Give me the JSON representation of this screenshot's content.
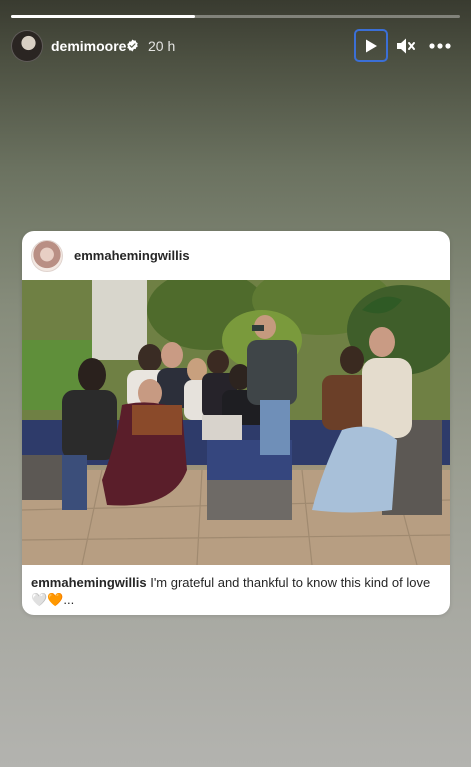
{
  "story": {
    "progress": 0.41
  },
  "header": {
    "username": "demimoore",
    "time": "20 h",
    "play_icon": "play-icon",
    "mute_icon": "speaker-muted-icon",
    "more_icon": "more-horizontal-icon",
    "verified_icon": "verified-badge-icon"
  },
  "post": {
    "username": "emmahemingwillis",
    "caption_user": "emmahemingwillis",
    "caption_text": " I'm grateful and thankful to know this kind of love 🤍🧡..."
  },
  "colors": {
    "play_focus_border": "#3b6fd6",
    "card_bg": "#ffffff"
  }
}
